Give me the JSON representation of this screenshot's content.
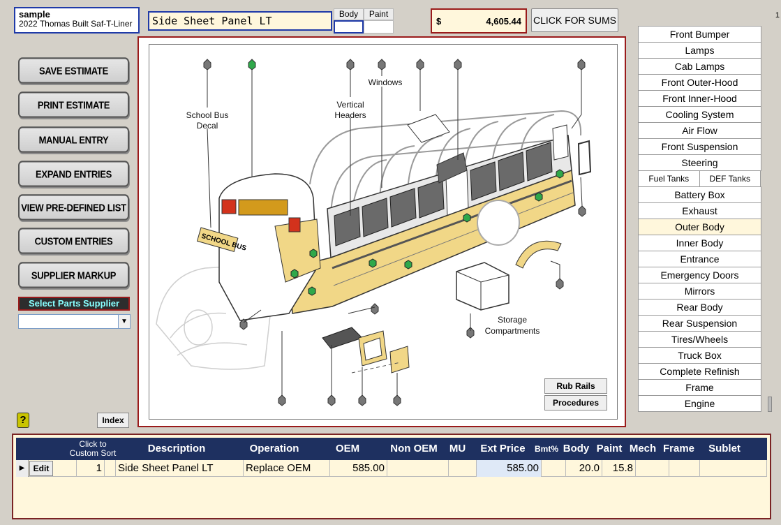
{
  "header": {
    "vehicle_name": "sample",
    "vehicle_desc": "2022 Thomas Built Saf-T-Liner",
    "part_name": "Side Sheet Panel LT",
    "body_label": "Body",
    "paint_label": "Paint",
    "currency": "$",
    "total": "4,605.44",
    "sums_button": "CLICK FOR SUMS",
    "page_number": "1"
  },
  "left_buttons": [
    "SAVE ESTIMATE",
    "PRINT ESTIMATE",
    "MANUAL ENTRY",
    "EXPAND ENTRIES",
    "VIEW PRE-DEFINED LIST",
    "CUSTOM ENTRIES",
    "SUPPLIER  MARKUP"
  ],
  "supplier": {
    "label": "Select Parts Supplier",
    "value": ""
  },
  "index_button": "Index",
  "diagram": {
    "labels": {
      "school_bus_decal_1": "School Bus",
      "school_bus_decal_2": "Decal",
      "windows": "Windows",
      "vertical_headers_1": "Vertical",
      "vertical_headers_2": "Headers",
      "storage_1": "Storage",
      "storage_2": "Compartments",
      "bus_sign": "SCHOOL BUS"
    },
    "rub_rails_button": "Rub Rails",
    "procedures_button": "Procedures"
  },
  "categories": [
    "Front Bumper",
    "Lamps",
    "Cab Lamps",
    "Front Outer-Hood",
    "Front Inner-Hood",
    "Cooling System",
    "Air Flow",
    "Front Suspension",
    "Steering"
  ],
  "split_category": {
    "left": "Fuel Tanks",
    "right": "DEF Tanks"
  },
  "categories_after": [
    "Battery Box",
    "Exhaust",
    "Outer Body",
    "Inner Body",
    "Entrance",
    "Emergency Doors",
    "Mirrors",
    "Rear Body",
    "Rear Suspension",
    "Tires/Wheels",
    "Truck Box",
    "Complete Refinish",
    "Frame",
    "Engine"
  ],
  "active_category": "Outer Body",
  "grid": {
    "headers": {
      "sort": "Click to\nCustom Sort",
      "description": "Description",
      "operation": "Operation",
      "oem": "OEM",
      "non_oem": "Non OEM",
      "mu": "MU",
      "ext_price": "Ext Price",
      "bmt": "Bmt%",
      "body": "Body",
      "paint": "Paint",
      "mech": "Mech",
      "frame": "Frame",
      "sublet": "Sublet"
    },
    "row": {
      "edit": "Edit",
      "line": "1",
      "description": "Side Sheet Panel LT",
      "operation": "Replace OEM",
      "oem": "585.00",
      "ext_price": "585.00",
      "body": "20.0",
      "paint": "15.8"
    }
  }
}
